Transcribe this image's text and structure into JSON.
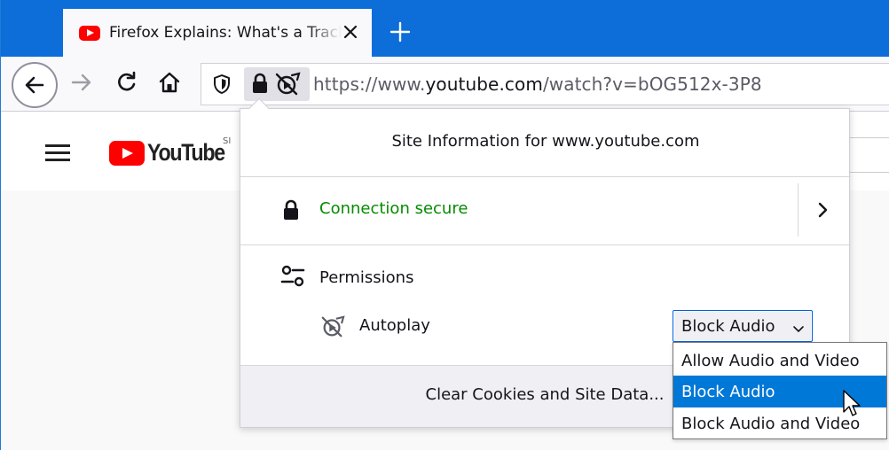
{
  "tab": {
    "title": "Firefox Explains: What's a Tracking Cookie?",
    "close_icon": "close-icon",
    "favicon": "youtube-favicon"
  },
  "newtab_icon": "plus-icon",
  "nav": {
    "back_icon": "back-arrow-icon",
    "forward_icon": "forward-arrow-icon",
    "reload_icon": "reload-icon",
    "home_icon": "home-icon"
  },
  "urlbar": {
    "scheme": "https://www.",
    "host": "youtube.com",
    "path": "/watch?v=bOG512x-3P8"
  },
  "page": {
    "logo_text": "YouTube",
    "logo_sup": "SI"
  },
  "panel": {
    "title": "Site Information for www.youtube.com",
    "connection_label": "Connection secure",
    "permissions_label": "Permissions",
    "autoplay_label": "Autoplay",
    "autoplay_value": "Block Audio",
    "clear_button": "Clear Cookies and Site Data..."
  },
  "dropdown": {
    "options": [
      "Allow Audio and Video",
      "Block Audio",
      "Block Audio and Video"
    ],
    "selected_index": 1
  },
  "colors": {
    "tabstrip": "#0d6dd9",
    "secure_green": "#058b00",
    "selection_blue": "#0078d7",
    "youtube_red": "#ff0000"
  }
}
